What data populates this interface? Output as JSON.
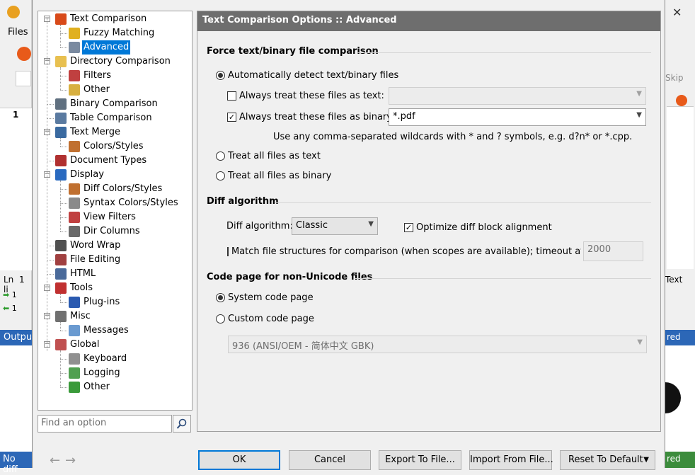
{
  "background": {
    "menu_files": "Files",
    "skip_label": "Skip",
    "line_num": "1",
    "ln_label": "Ln",
    "ln_value": "1 li",
    "text_label": "Text",
    "output_label": "Output",
    "output_right": "red",
    "status_left": "No diff",
    "status_right": "red",
    "row1": "1",
    "row2": "1",
    "close_glyph": "✕"
  },
  "tree": {
    "items": [
      {
        "label": "Text Comparison",
        "icon": "apple-icon"
      },
      {
        "label": "Fuzzy Matching",
        "icon": "bunny-icon"
      },
      {
        "label": "Advanced",
        "icon": "gear-doc-icon"
      },
      {
        "label": "Directory Comparison",
        "icon": "folders-icon"
      },
      {
        "label": "Filters",
        "icon": "filter-icon"
      },
      {
        "label": "Other",
        "icon": "folder-gear-icon"
      },
      {
        "label": "Binary Comparison",
        "icon": "binary-icon"
      },
      {
        "label": "Table Comparison",
        "icon": "table-icon"
      },
      {
        "label": "Text Merge",
        "icon": "merge-icon"
      },
      {
        "label": "Colors/Styles",
        "icon": "palette-icon"
      },
      {
        "label": "Document Types",
        "icon": "doc-types-icon"
      },
      {
        "label": "Display",
        "icon": "monitor-icon"
      },
      {
        "label": "Diff Colors/Styles",
        "icon": "palette-icon"
      },
      {
        "label": "Syntax Colors/Styles",
        "icon": "syntax-icon"
      },
      {
        "label": "View Filters",
        "icon": "filter-icon"
      },
      {
        "label": "Dir Columns",
        "icon": "columns-icon"
      },
      {
        "label": "Word Wrap",
        "icon": "wrap-icon"
      },
      {
        "label": "File Editing",
        "icon": "edit-icon"
      },
      {
        "label": "HTML",
        "icon": "html-icon"
      },
      {
        "label": "Tools",
        "icon": "tools-icon"
      },
      {
        "label": "Plug-ins",
        "icon": "puzzle-icon"
      },
      {
        "label": "Misc",
        "icon": "misc-icon"
      },
      {
        "label": "Messages",
        "icon": "message-icon"
      },
      {
        "label": "Global",
        "icon": "people-icon"
      },
      {
        "label": "Keyboard",
        "icon": "keyboard-icon"
      },
      {
        "label": "Logging",
        "icon": "log-icon"
      },
      {
        "label": "Other",
        "icon": "shield-icon"
      }
    ],
    "selected": "Advanced"
  },
  "search": {
    "placeholder": "Find an option"
  },
  "panel": {
    "header": "Text Comparison Options :: Advanced",
    "force_group": "Force text/binary file comparison",
    "auto_detect": "Automatically detect text/binary files",
    "always_text": "Always treat these files as text:",
    "always_text_value": "",
    "always_binary": "Always treat these files as binary:",
    "always_binary_value": "*.pdf",
    "wildcard_hint": "Use any comma-separated wildcards with * and ? symbols, e.g. d?n* or *.cpp.",
    "treat_text": "Treat all files as text",
    "treat_binary": "Treat all files as binary",
    "diff_group": "Diff algorithm",
    "diff_algo_label": "Diff algorithm:",
    "diff_algo_value": "Classic",
    "optimize": "Optimize diff block alignment",
    "match_structures": "Match file structures for comparison (when scopes are available); timeout after (ms",
    "timeout_value": "2000",
    "codepage_group": "Code page for non-Unicode files",
    "system_cp": "System code page",
    "custom_cp": "Custom code page",
    "custom_cp_value": "936   (ANSI/OEM - 简体中文 GBK)"
  },
  "buttons": {
    "ok": "OK",
    "cancel": "Cancel",
    "export": "Export To File...",
    "import": "Import From File...",
    "reset": "Reset To Default",
    "back_arrow": "←",
    "forward_arrow": "→"
  },
  "colors": {
    "header_bg": "#6e6e6e",
    "selection": "#0078d7",
    "status_blue": "#2c67b7"
  }
}
